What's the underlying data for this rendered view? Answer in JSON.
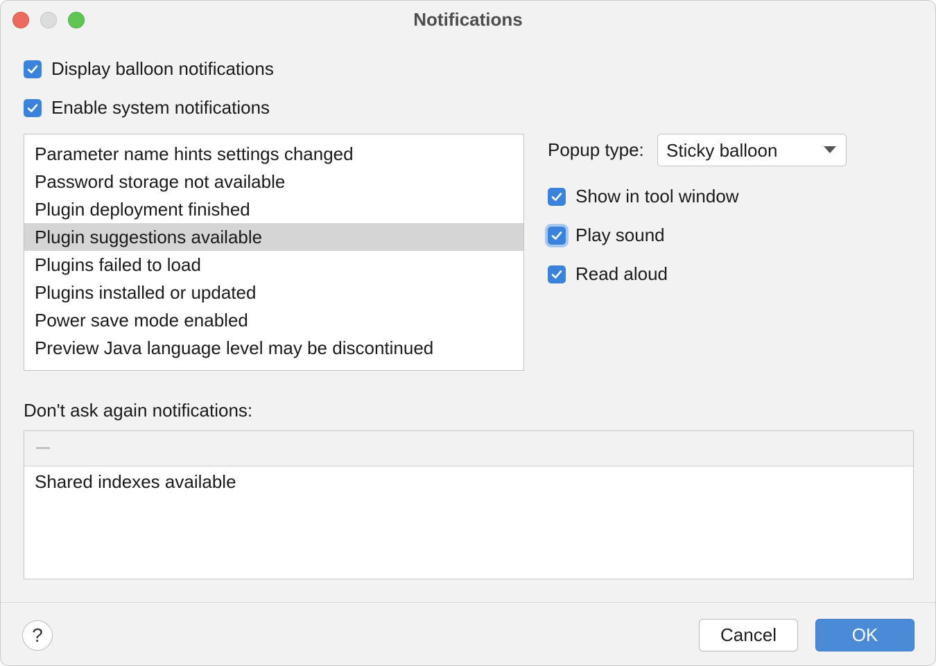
{
  "window": {
    "title": "Notifications"
  },
  "options": {
    "display_balloon": {
      "label": "Display balloon notifications",
      "checked": true
    },
    "enable_system": {
      "label": "Enable system notifications",
      "checked": true
    }
  },
  "notification_groups": {
    "items": [
      {
        "label": "Parameter name hints settings changed",
        "selected": false
      },
      {
        "label": "Password storage not available",
        "selected": false
      },
      {
        "label": "Plugin deployment finished",
        "selected": false
      },
      {
        "label": "Plugin suggestions available",
        "selected": true
      },
      {
        "label": "Plugins failed to load",
        "selected": false
      },
      {
        "label": "Plugins installed or updated",
        "selected": false
      },
      {
        "label": "Power save mode enabled",
        "selected": false
      },
      {
        "label": "Preview Java language level may be discontinued",
        "selected": false
      }
    ]
  },
  "group_settings": {
    "popup_type_label": "Popup type:",
    "popup_type_value": "Sticky balloon",
    "show_in_tool_window": {
      "label": "Show in tool window",
      "checked": true
    },
    "play_sound": {
      "label": "Play sound",
      "checked": true
    },
    "read_aloud": {
      "label": "Read aloud",
      "checked": true
    }
  },
  "dont_ask_again": {
    "label": "Don't ask again notifications:",
    "items": [
      "Shared indexes available"
    ]
  },
  "footer": {
    "help_label": "?",
    "cancel_label": "Cancel",
    "ok_label": "OK"
  },
  "colors": {
    "accent": "#3b82dd",
    "ok_button": "#4b8ad6",
    "selection": "#d5d5d5",
    "window_bg": "#f2f2f2"
  }
}
